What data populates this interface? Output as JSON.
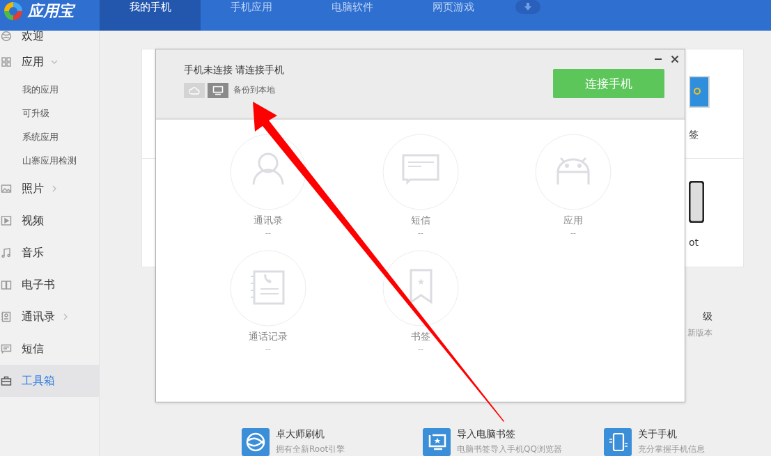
{
  "app": {
    "logo": "应用宝"
  },
  "nav_tabs": [
    {
      "label": "我的手机",
      "selected": true
    },
    {
      "label": "手机应用",
      "selected": false
    },
    {
      "label": "电脑软件",
      "selected": false
    },
    {
      "label": "网页游戏",
      "selected": false
    }
  ],
  "sidebar": {
    "items": [
      {
        "label": "欢迎",
        "selected": false
      },
      {
        "label": "应用",
        "selected": false,
        "expanded": true,
        "children": [
          {
            "label": "我的应用"
          },
          {
            "label": "可升级"
          },
          {
            "label": "系统应用"
          },
          {
            "label": "山寨应用检测"
          }
        ]
      },
      {
        "label": "照片",
        "selected": false,
        "expanded": false
      },
      {
        "label": "视频",
        "selected": false
      },
      {
        "label": "音乐",
        "selected": false
      },
      {
        "label": "电子书",
        "selected": false
      },
      {
        "label": "通讯录",
        "selected": false,
        "expanded": false
      },
      {
        "label": "短信",
        "selected": false
      },
      {
        "label": "工具箱",
        "selected": true
      }
    ]
  },
  "background": {
    "card_texts": [
      "签",
      "ot"
    ],
    "tool_partial": {
      "title": "级",
      "subtitle": "新版本"
    },
    "tools": [
      {
        "title": "卓大师刷机",
        "subtitle": "拥有全新Root引擎"
      },
      {
        "title": "导入电脑书签",
        "subtitle": "电脑书签导入手机QQ浏览器"
      },
      {
        "title": "关于手机",
        "subtitle": "充分掌握手机信息"
      }
    ]
  },
  "dialog": {
    "status": "手机未连接 请连接手机",
    "backup_label": "备份到本地",
    "connect_button": "连接手机",
    "items": [
      {
        "label": "通讯录",
        "count": "--"
      },
      {
        "label": "短信",
        "count": "--"
      },
      {
        "label": "应用",
        "count": "--"
      },
      {
        "label": "通话记录",
        "count": "--"
      },
      {
        "label": "书签",
        "count": "--"
      }
    ]
  }
}
